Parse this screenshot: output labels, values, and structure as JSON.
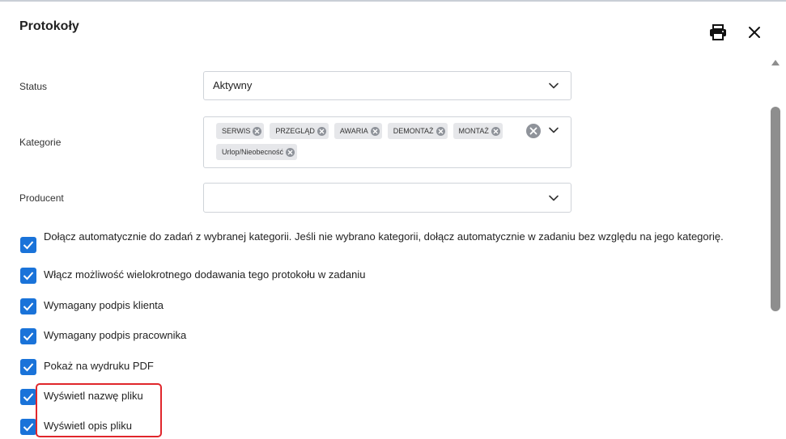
{
  "dialog": {
    "title": "Protokoły"
  },
  "header": {
    "print_icon": "printer-icon",
    "close_icon": "close-icon"
  },
  "form": {
    "status": {
      "label": "Status",
      "value": "Aktywny"
    },
    "kategorie": {
      "label": "Kategorie",
      "tags": [
        "SERWIS",
        "PRZEGLĄD",
        "AWARIA",
        "DEMONTAŻ",
        "MONTAŻ",
        "Urlop/Nieobecność"
      ]
    },
    "producent": {
      "label": "Producent",
      "value": ""
    }
  },
  "checkboxes": [
    {
      "label": "Dołącz automatycznie do zadań z wybranej kategorii. Jeśli nie wybrano kategorii, dołącz automatycznie w zadaniu bez względu na jego kategorię.",
      "checked": true
    },
    {
      "label": "Włącz możliwość wielokrotnego dodawania tego protokołu w zadaniu",
      "checked": true
    },
    {
      "label": "Wymagany podpis klienta",
      "checked": true
    },
    {
      "label": "Wymagany podpis pracownika",
      "checked": true
    },
    {
      "label": "Pokaż na wydruku PDF",
      "checked": true
    },
    {
      "label": "Wyświetl nazwę pliku",
      "checked": true
    },
    {
      "label": "Wyświetl opis pliku",
      "checked": true
    }
  ],
  "colors": {
    "accent": "#1a73d9",
    "highlight": "#e0262b"
  }
}
